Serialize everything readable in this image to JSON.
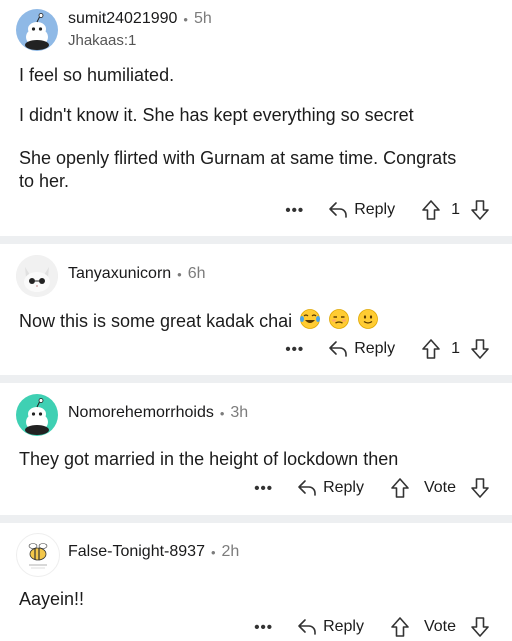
{
  "comments": [
    {
      "username": "sumit24021990",
      "time": "5h",
      "flair": "Jhakaas:1",
      "paragraphs": [
        "I feel so humiliated.",
        "I didn't know it. She has kept everything so secret",
        "She openly flirted with Gurnam at same time. Congrats to her."
      ],
      "more": "•••",
      "reply_label": "Reply",
      "vote_label": "1",
      "avatar_icon": "reddit-snoo-avatar-icon"
    },
    {
      "username": "Tanyaxunicorn",
      "time": "6h",
      "paragraphs": [
        "Now this is some great kadak chai"
      ],
      "emojis": [
        "tears-of-joy-emoji",
        "unamused-emoji",
        "slightly-smiling-emoji"
      ],
      "more": "•••",
      "reply_label": "Reply",
      "vote_label": "1",
      "avatar_icon": "cat-sunglasses-avatar-icon"
    },
    {
      "username": "Nomorehemorrhoids",
      "time": "3h",
      "paragraphs": [
        "They got married in the height of lockdown then"
      ],
      "more": "•••",
      "reply_label": "Reply",
      "vote_label": "Vote",
      "avatar_icon": "reddit-snoo-teal-avatar-icon"
    },
    {
      "username": "False-Tonight-8937",
      "time": "2h",
      "paragraphs": [
        "Aayein!!"
      ],
      "more": "•••",
      "reply_label": "Reply",
      "vote_label": "Vote",
      "avatar_icon": "bee-avatar-icon"
    }
  ],
  "separator": "•",
  "colors": {
    "separator": "#edeff1",
    "snoo_blue": "#8fb9e6",
    "snoo_teal": "#3fd0b3",
    "meta_gray": "#7c7c7c"
  }
}
